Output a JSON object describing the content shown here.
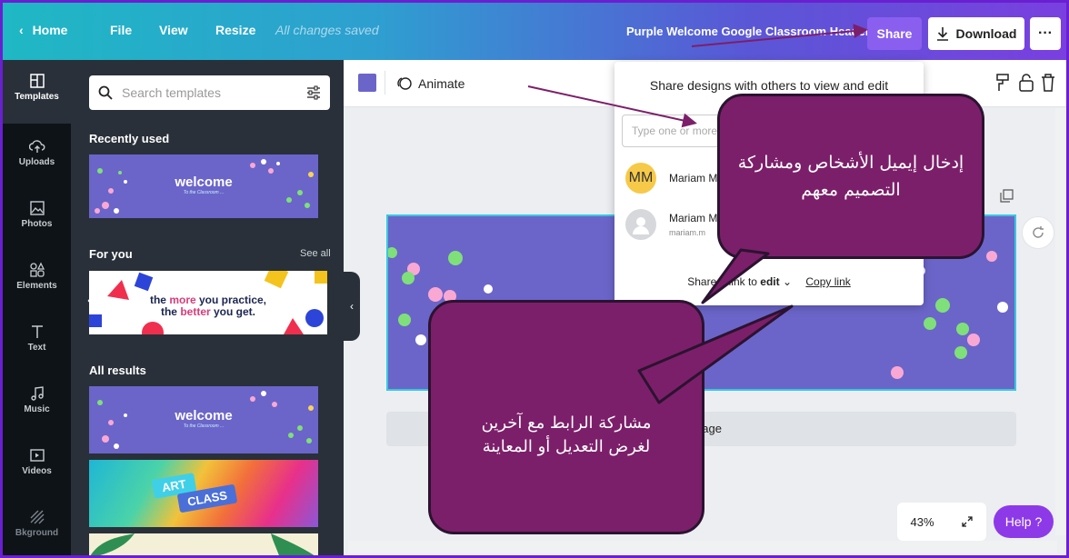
{
  "topbar": {
    "home": "Home",
    "file": "File",
    "view": "View",
    "resize": "Resize",
    "saved_status": "All changes saved",
    "doc_title": "Purple Welcome Google Classroom Header",
    "share": "Share",
    "download": "Download",
    "more": "···"
  },
  "rail": {
    "items": [
      {
        "label": "Templates",
        "icon": "templates-icon"
      },
      {
        "label": "Uploads",
        "icon": "upload-cloud-icon"
      },
      {
        "label": "Photos",
        "icon": "photo-icon"
      },
      {
        "label": "Elements",
        "icon": "shapes-icon"
      },
      {
        "label": "Text",
        "icon": "text-icon"
      },
      {
        "label": "Music",
        "icon": "music-note-icon"
      },
      {
        "label": "Videos",
        "icon": "video-play-icon"
      },
      {
        "label": "Bkground",
        "icon": "background-hatch-icon"
      }
    ]
  },
  "panel": {
    "search_placeholder": "Search templates",
    "recently_used": "Recently used",
    "for_you": "For you",
    "see_all": "See all",
    "all_results": "All results",
    "welcome_text": "welcome",
    "welcome_sub": "To the Classroom ...",
    "practice_line1_a": "the ",
    "practice_line1_b": "more",
    "practice_line1_c": " you practice,",
    "practice_line2_a": "the ",
    "practice_line2_b": "better",
    "practice_line2_c": " you get.",
    "art_word": "ART",
    "class_word": "CLASS"
  },
  "editor": {
    "animate": "Animate",
    "add_page_partial": "page",
    "zoom": "43%",
    "help": "Help ?"
  },
  "share_popup": {
    "title": "Share designs with others to view and edit",
    "input_placeholder": "Type one or more",
    "member1_initials": "MM",
    "member1_name": "Mariam M",
    "member2_name": "Mariam M",
    "member2_email": "mariam.m",
    "link_prefix": "Share a link to ",
    "link_mode": "edit",
    "copy_link": "Copy link"
  },
  "annotations": {
    "top": "إدخال إيميل الأشخاص ومشاركة التصميم معهم",
    "bottom": "مشاركة الرابط مع آخرين لغرض التعديل أو المعاينة"
  },
  "colors": {
    "accent_purple": "#8a5ff0",
    "design_bg": "#6b65c9",
    "bubble": "#7c1f6a",
    "help": "#8d39e8"
  }
}
